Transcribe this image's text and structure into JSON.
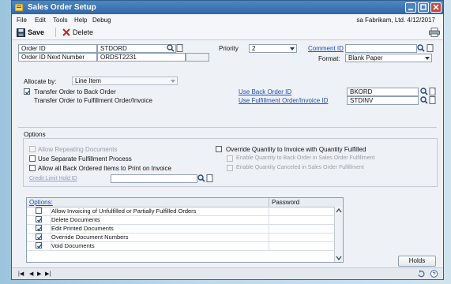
{
  "window": {
    "title": "Sales Order Setup"
  },
  "menu": {
    "items": [
      "File",
      "Edit",
      "Tools",
      "Help",
      "Debug"
    ],
    "company": "sa  Fabrikam, Ltd.  4/12/2017"
  },
  "toolbar": {
    "save_label": "Save",
    "delete_label": "Delete"
  },
  "form": {
    "order_id_label": "Order ID",
    "order_id_value": "STDORD",
    "order_id_next_label": "Order ID Next Number",
    "order_id_next_value": "ORDST2231",
    "priority_label": "Priority",
    "priority_value": "2",
    "comment_id_label": "Comment ID",
    "comment_id_value": "",
    "format_label": "Format:",
    "format_value": "Blank Paper",
    "allocate_label": "Allocate by:",
    "allocate_value": "Line Item",
    "transfer_back_label": "Transfer Order to Back Order",
    "transfer_back_checked": true,
    "transfer_fulfill_label": "Transfer Order to Fulfillment Order/Invoice",
    "use_back_order_id_label": "Use Back Order ID",
    "use_back_order_id_value": "BKORD",
    "use_fulfillment_id_label": "Use Fulfillment Order/Invoice ID",
    "use_fulfillment_id_value": "STDINV"
  },
  "options": {
    "group_label": "Options",
    "allow_repeating": "Allow Repeating Documents",
    "use_separate": "Use Separate Fulfillment Process",
    "allow_back_ordered": "Allow all Back Ordered Items to Print on Invoice",
    "credit_limit_label": "Credit Limit Hold ID",
    "credit_limit_value": "",
    "override_qty": "Override Quantity to Invoice with Quantity Fulfilled",
    "override_back": "Enable Quantity to Back Order in Sales Order Fulfillment",
    "override_canceled": "Enable Quantity Canceled in Sales Order Fulfillment"
  },
  "grid": {
    "col_options": "Options:",
    "col_password": "Password",
    "rows": [
      {
        "label": "Allow Invoicing of Unfulfilled or Partially Fulfilled Orders",
        "checked": false
      },
      {
        "label": "Delete Documents",
        "checked": true
      },
      {
        "label": "Edit Printed Documents",
        "checked": true
      },
      {
        "label": "Override Document Numbers",
        "checked": true
      },
      {
        "label": "Void Documents",
        "checked": true
      }
    ]
  },
  "buttons": {
    "holds": "Holds"
  },
  "status": {
    "nav": [
      "|◀",
      "◀",
      "▶",
      "▶|"
    ]
  }
}
